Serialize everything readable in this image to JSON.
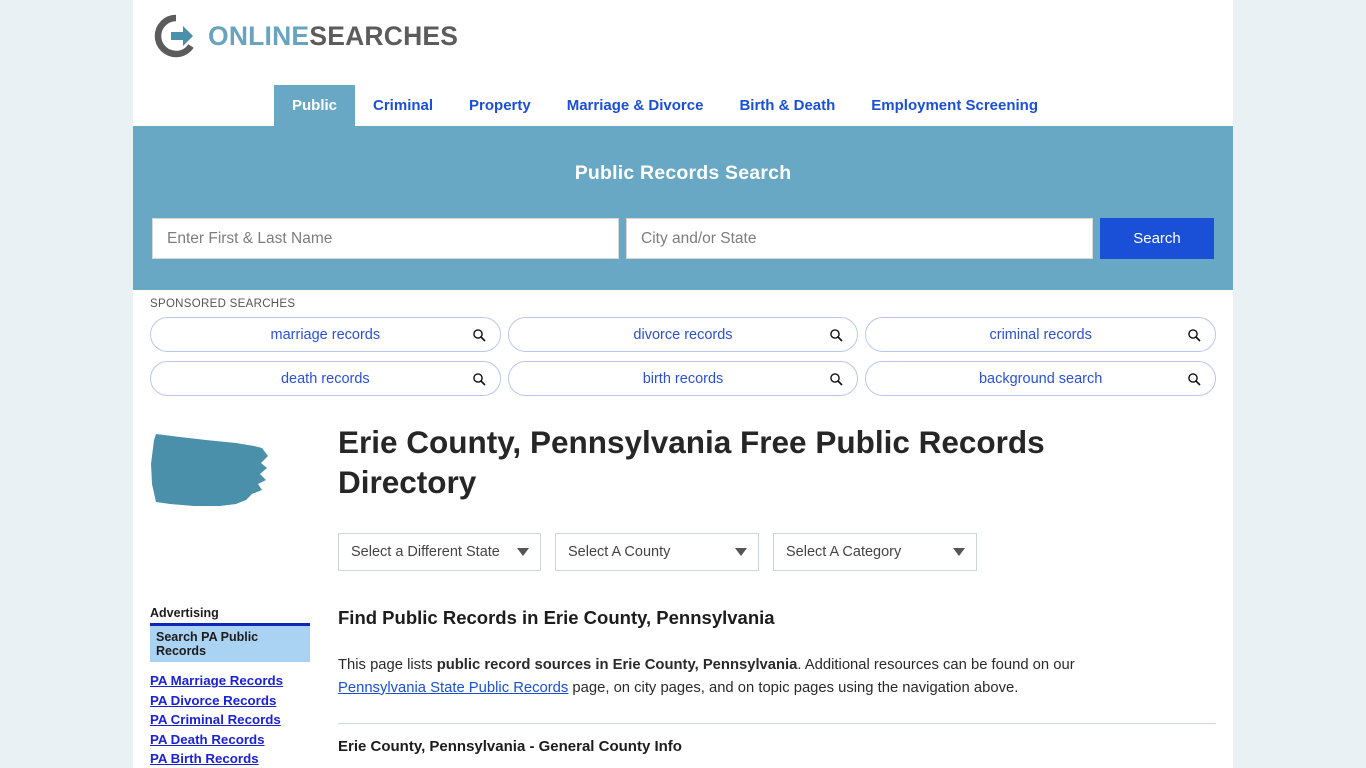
{
  "site": {
    "logo_primary": "ONLINE",
    "logo_secondary": "SEARCHES",
    "accent_blue": "#68a8c4",
    "link_blue": "#1a4fd8",
    "page_bg": "#eaf1f5"
  },
  "nav": {
    "tabs": [
      {
        "label": "Public",
        "active": true
      },
      {
        "label": "Criminal",
        "active": false
      },
      {
        "label": "Property",
        "active": false
      },
      {
        "label": "Marriage & Divorce",
        "active": false
      },
      {
        "label": "Birth & Death",
        "active": false
      },
      {
        "label": "Employment Screening",
        "active": false
      }
    ]
  },
  "search": {
    "title": "Public Records Search",
    "name_placeholder": "Enter First & Last Name",
    "name_value": "",
    "place_placeholder": "City and/or State",
    "place_value": "",
    "button_label": "Search"
  },
  "sponsored": {
    "label": "SPONSORED SEARCHES",
    "items": [
      {
        "label": "marriage records"
      },
      {
        "label": "divorce records"
      },
      {
        "label": "criminal records"
      },
      {
        "label": "death records"
      },
      {
        "label": "birth records"
      },
      {
        "label": "background search"
      }
    ]
  },
  "main": {
    "title": "Erie County, Pennsylvania Free Public Records Directory",
    "state_shape_name": "pennsylvania",
    "selects": [
      {
        "label": "Select a Different State"
      },
      {
        "label": "Select A County"
      },
      {
        "label": "Select A Category"
      }
    ],
    "section_heading": "Find Public Records in Erie County, Pennsylvania",
    "intro": {
      "part1": "This page lists ",
      "bold": "public record sources in Erie County, Pennsylvania",
      "part2": ". Additional resources can be found on our ",
      "link": "Pennsylvania State Public Records",
      "part3": " page, on city pages, and on topic pages using the navigation above."
    },
    "sub_heading": "Erie County, Pennsylvania - General County Info"
  },
  "sidebar": {
    "ad_label": "Advertising",
    "box_title": "Search PA Public Records",
    "links": [
      {
        "label": "PA Marriage Records"
      },
      {
        "label": "PA Divorce Records"
      },
      {
        "label": "PA Criminal Records"
      },
      {
        "label": "PA Death Records"
      },
      {
        "label": "PA Birth Records"
      }
    ]
  }
}
